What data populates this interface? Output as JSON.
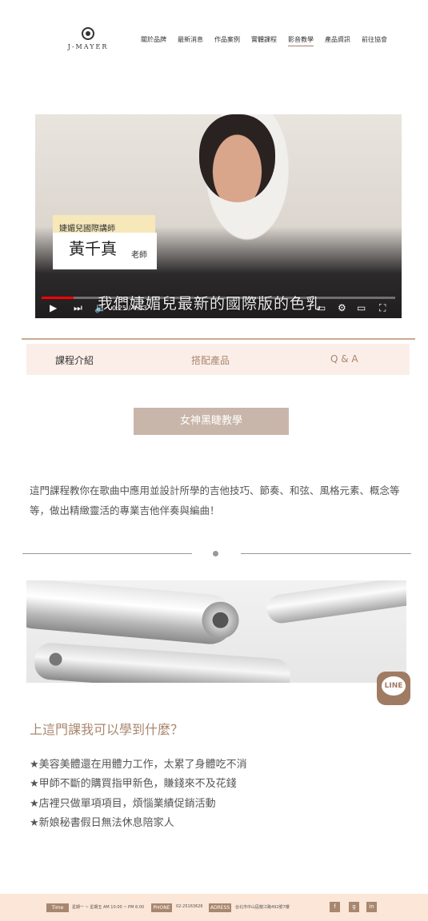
{
  "header": {
    "logo_text": "J-MAYER",
    "nav": [
      "關於品牌",
      "最新消息",
      "作品案例",
      "實體課程",
      "影音教學",
      "產品資訊",
      "前往協會"
    ],
    "active_index": 4
  },
  "video": {
    "caption_title": "婕媚兒國際講師",
    "caption_name": "黃千真",
    "caption_suffix": "老師",
    "subtitle": "我們婕媚兒最新的國際版的色乳",
    "time": "0:25 / 4:33",
    "progress": 0.09
  },
  "tabs": [
    "課程介紹",
    "搭配產品",
    "Q & A"
  ],
  "course_button": "女神黑睫教學",
  "description": "這門課程教你在歌曲中應用並設計所學的吉他技巧、節奏、和弦、風格元素、概念等等，做出精緻靈活的專業吉他伴奏與編曲！",
  "section_title": "上這門課我可以學到什麼？",
  "benefits": [
    "★美容美體還在用體力工作，太累了身體吃不消",
    "★甲師不斷的購買指甲新色，賺錢來不及花錢",
    "★店裡只做單項項目，煩惱業績促銷活動",
    "★新娘秘書假日無法休息陪家人"
  ],
  "line_label": "LINE",
  "footer": {
    "time_label": "Time",
    "time_value": "星期一 ~ 星期五 AM 10:00 ~ PM 6:00",
    "phone_label": "PHONE",
    "phone_value": "02-25163626",
    "address_label": "ADRESS",
    "address_value": "台北市中山區龍江路492號7樓",
    "social": [
      "f",
      "g",
      "in"
    ]
  },
  "colors": {
    "accent": "#a8876f",
    "tab_bg": "#fbeee8",
    "footer_bg": "#fbe6d8",
    "button": "#c9b6aa"
  }
}
